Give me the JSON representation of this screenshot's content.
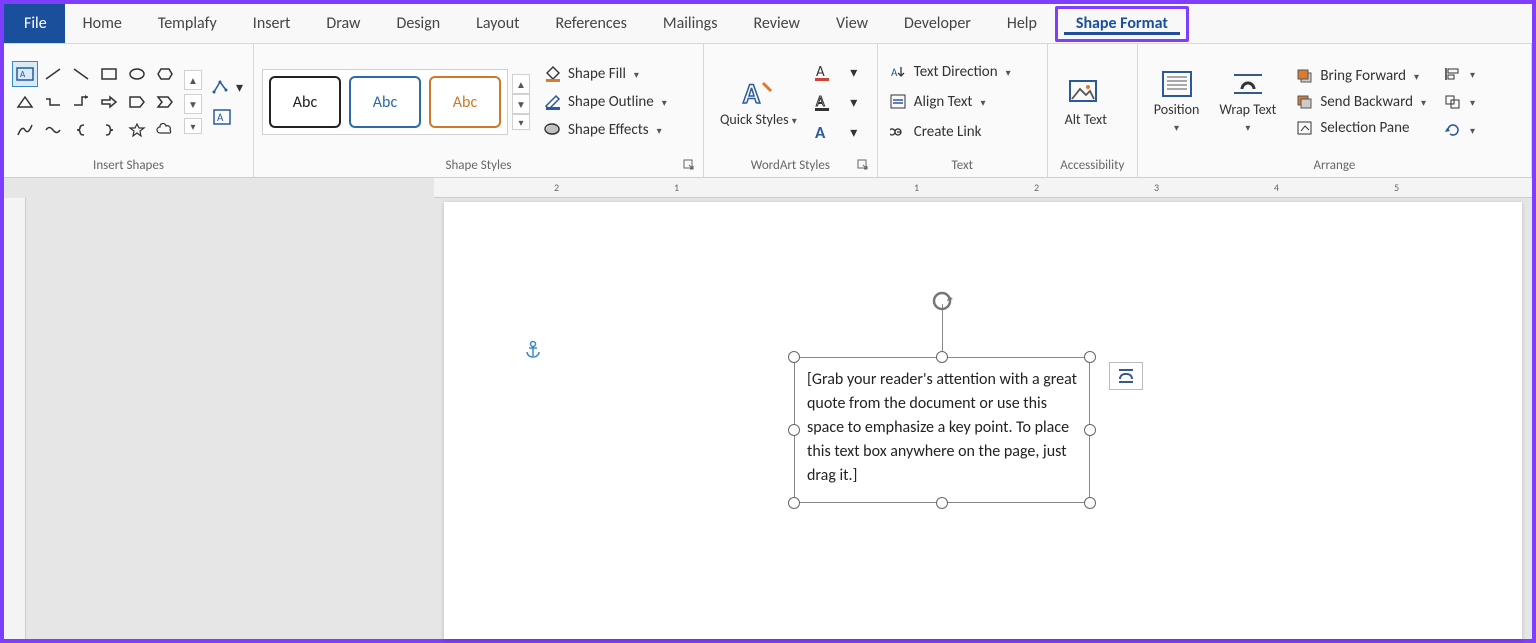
{
  "tabs": [
    "File",
    "Home",
    "Templafy",
    "Insert",
    "Draw",
    "Design",
    "Layout",
    "References",
    "Mailings",
    "Review",
    "View",
    "Developer",
    "Help",
    "Shape Format"
  ],
  "ribbon": {
    "insert_shapes": {
      "label": "Insert Shapes"
    },
    "shape_styles": {
      "label": "Shape Styles",
      "swatch_text": "Abc",
      "fill": "Shape Fill",
      "outline": "Shape Outline",
      "effects": "Shape Effects"
    },
    "wordart": {
      "label": "WordArt Styles",
      "quick_styles": "Quick Styles"
    },
    "text": {
      "label": "Text",
      "direction": "Text Direction",
      "align": "Align Text",
      "link": "Create Link"
    },
    "accessibility": {
      "label": "Accessibility",
      "alt_text": "Alt Text"
    },
    "arrange": {
      "label": "Arrange",
      "position": "Position",
      "wrap": "Wrap Text",
      "bring_forward": "Bring Forward",
      "send_backward": "Send Backward",
      "selection_pane": "Selection Pane"
    }
  },
  "ruler": {
    "marks": [
      "2",
      "1",
      "1",
      "2",
      "3",
      "4",
      "5"
    ]
  },
  "textbox_content": "[Grab your reader's attention with a great quote from the document or use this space to emphasize a key point. To place this text box anywhere on the page, just drag it.]"
}
